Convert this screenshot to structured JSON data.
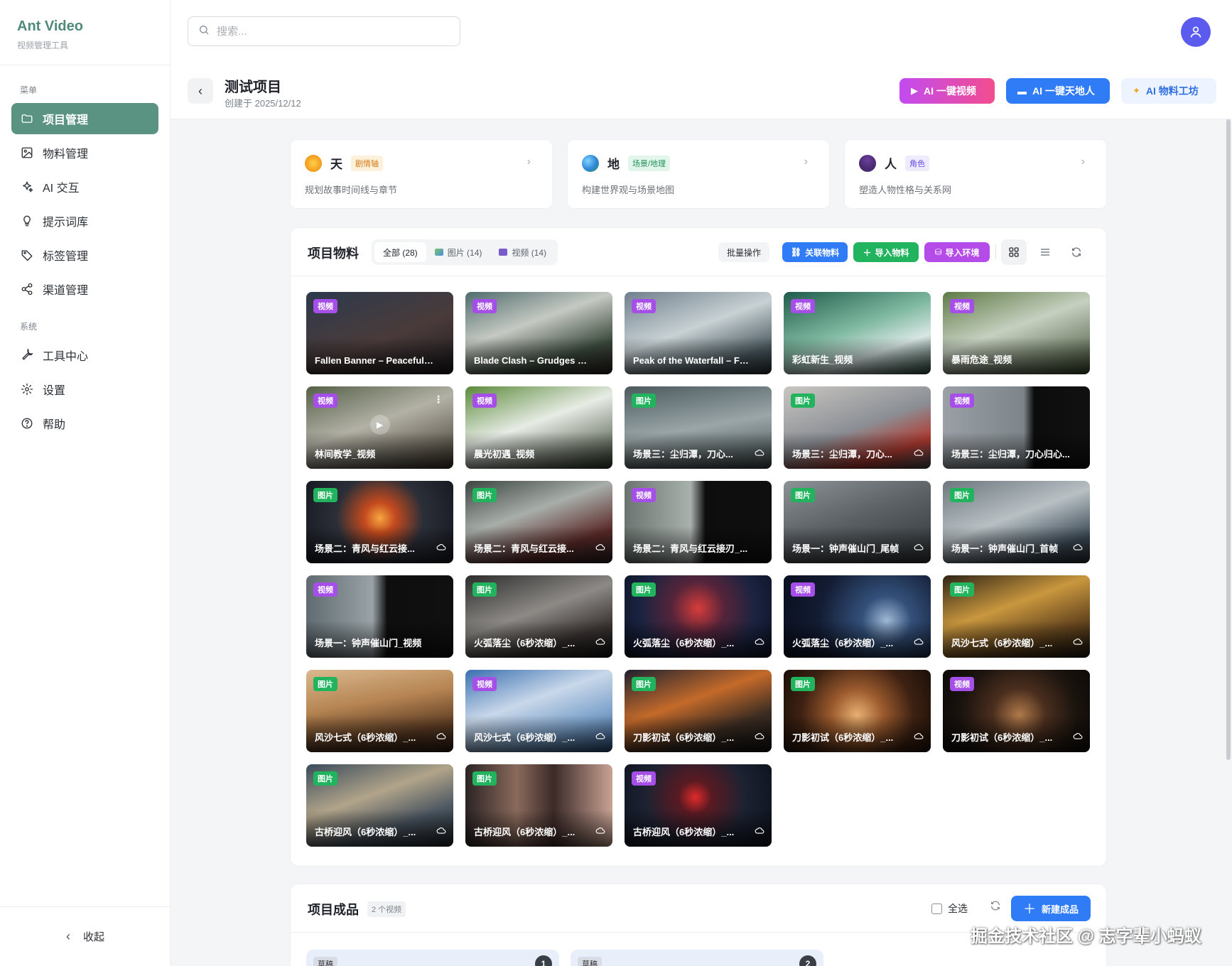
{
  "brand": {
    "name": "Ant Video",
    "subtitle": "视频管理工具"
  },
  "sidebar": {
    "menu_label": "菜单",
    "menu_items": [
      {
        "label": "项目管理",
        "icon": "folder-icon",
        "active": true
      },
      {
        "label": "物料管理",
        "icon": "image-icon"
      },
      {
        "label": "AI 交互",
        "icon": "sparkle-icon"
      },
      {
        "label": "提示词库",
        "icon": "lightbulb-icon"
      },
      {
        "label": "标签管理",
        "icon": "tag-icon"
      },
      {
        "label": "渠道管理",
        "icon": "share-icon"
      }
    ],
    "system_label": "系统",
    "system_items": [
      {
        "label": "工具中心",
        "icon": "wrench-icon"
      },
      {
        "label": "设置",
        "icon": "gear-icon"
      },
      {
        "label": "帮助",
        "icon": "help-icon"
      }
    ],
    "collapse_label": "收起"
  },
  "search": {
    "placeholder": "搜索..."
  },
  "project": {
    "title": "测试项目",
    "created": "创建于 2025/12/12",
    "buttons": {
      "ai_video": "AI 一键视频",
      "ai_world": "AI 一键天地人",
      "ai_lab": "AI 物料工坊"
    }
  },
  "cards": [
    {
      "name": "天",
      "tag": "剧情轴",
      "desc": "规划故事时间线与章节",
      "tag_bg": "#fdf1dc",
      "tag_fg": "#d07a16",
      "icon": "sun-icon"
    },
    {
      "name": "地",
      "tag": "场景/地理",
      "desc": "构建世界观与场景地图",
      "tag_bg": "#e3f6ec",
      "tag_fg": "#23915a",
      "icon": "globe-icon"
    },
    {
      "name": "人",
      "tag": "角色",
      "desc": "塑造人物性格与关系网",
      "tag_bg": "#eeeaff",
      "tag_fg": "#6a4ee0",
      "icon": "person-icon"
    }
  ],
  "materials": {
    "title": "项目物料",
    "filters": [
      "全部 (28)",
      "图片 (14)",
      "视频 (14)"
    ],
    "batch": "批量操作",
    "link": "关联物料",
    "import": "导入物料",
    "import_env": "导入环境",
    "items": [
      {
        "type": "视频",
        "kind": "video",
        "name": "Fallen Banner – Peaceful R...",
        "bg": "linear-gradient(160deg,#2d3a4d 0%,#4a3b3a 55%,#1d1a1d 100%)"
      },
      {
        "type": "视频",
        "kind": "video",
        "name": "Blade Clash – Grudges Unl...",
        "bg": "linear-gradient(160deg,#4f6b6d 0%,#c5c9c2 40%,#3b4a3d 75%,#2a2320 100%)"
      },
      {
        "type": "视频",
        "kind": "video",
        "name": "Peak of the Waterfall – Fou...",
        "bg": "linear-gradient(160deg,#6f7f8c 0%,#c8d1d4 45%,#4b5a60 80%,#2e3437 100%)"
      },
      {
        "type": "视频",
        "kind": "video",
        "name": "彩虹新生_视频",
        "bg": "linear-gradient(160deg,#1f5b4a 0%,#7fb9a1 45%,#d8e6e4 70%,#2c4a3f 100%)"
      },
      {
        "type": "视频",
        "kind": "video",
        "name": "暴雨危途_视频",
        "bg": "linear-gradient(160deg,#5e7a45 0%,#c6d0c0 45%,#3a4a2e 100%)"
      },
      {
        "type": "视频",
        "kind": "video",
        "name": "林间教学_视频",
        "bg": "linear-gradient(160deg,#556148 0%,#b3b1a6 45%,#3b3328 100%)",
        "play": true
      },
      {
        "type": "视频",
        "kind": "video",
        "name": "晨光初遇_视频",
        "bg": "linear-gradient(160deg,#5b8a3a 0%,#e7ece5 45%,#2f3a28 100%)"
      },
      {
        "type": "图片",
        "kind": "image",
        "name": "场景三：尘归潭，刀心...",
        "bg": "linear-gradient(170deg,#4c5a5e 0%,#9aa6a8 50%,#3e484a 100%)",
        "cloud": true
      },
      {
        "type": "图片",
        "kind": "image",
        "name": "场景三：尘归潭，刀心...",
        "bg": "linear-gradient(160deg,#c9c6c1 0%,#8b8f95 50%,#b13a30 78%,#4a4d52 100%)",
        "cloud": true
      },
      {
        "type": "视频",
        "kind": "video",
        "name": "场景三：尘归潭，刀心归心...",
        "bg": "linear-gradient(90deg,#9aa0a5 0%,#7d858a 55%,#0c0c0c 62%,#111 100%)"
      },
      {
        "type": "图片",
        "kind": "image",
        "name": "场景二：青风与红云接...",
        "bg": "radial-gradient(circle at 50% 45%,#f6a640 0%,#c44a1e 18%,#2b2f38 50%,#15181f 100%)",
        "cloud": true
      },
      {
        "type": "图片",
        "kind": "image",
        "name": "场景二：青风与红云接...",
        "bg": "linear-gradient(160deg,#3c4540 0%,#a8aeaa 40%,#5b2a28 75%,#2a2324 100%)",
        "cloud": true
      },
      {
        "type": "视频",
        "kind": "video",
        "name": "场景二：青风与红云接刃_...",
        "bg": "linear-gradient(90deg,#6b7470 0%,#a9b1ad 45%,#0d0d0d 55%,#0f0f0f 100%)"
      },
      {
        "type": "图片",
        "kind": "image",
        "name": "场景一：钟声催山门_尾帧",
        "bg": "linear-gradient(160deg,#8d9296 0%,#5c6266 45%,#2f3437 100%)",
        "cloud": true
      },
      {
        "type": "图片",
        "kind": "image",
        "name": "场景一：钟声催山门_首帧",
        "bg": "linear-gradient(160deg,#6d777d 0%,#b8c0c4 45%,#3c4a56 80%,#2a2f33 100%)",
        "cloud": true
      },
      {
        "type": "视频",
        "kind": "video",
        "name": "场景一：钟声催山门_视频",
        "bg": "linear-gradient(90deg,#5f6b70 0%,#9aa3a7 45%,#0e0e0e 55%,#101010 100%)"
      },
      {
        "type": "图片",
        "kind": "image",
        "name": "火弧落尘（6秒浓缩）_...",
        "bg": "linear-gradient(160deg,#2d2c2c 0%,#8d8a86 45%,#3b3533 75%,#141414 100%)",
        "cloud": true
      },
      {
        "type": "图片",
        "kind": "image",
        "name": "火弧落尘（6秒浓缩）_...",
        "bg": "radial-gradient(circle at 50% 40%,#d63c3a 0%,#55243a 30%,#1a2340 65%,#0d1224 100%)",
        "cloud": true
      },
      {
        "type": "视频",
        "kind": "video",
        "name": "火弧落尘（6秒浓缩）_...",
        "bg": "radial-gradient(circle at 70% 55%,#9eb8d6 0%,#33507a 22%,#131c33 60%,#0a0f1f 100%)",
        "cloud": true
      },
      {
        "type": "图片",
        "kind": "image",
        "name": "风沙七式（6秒浓缩）_...",
        "bg": "linear-gradient(160deg,#2f2416 0%,#c9973e 40%,#6b4a20 70%,#1c150e 100%)",
        "cloud": true
      },
      {
        "type": "图片",
        "kind": "image",
        "name": "风沙七式（6秒浓缩）_...",
        "bg": "linear-gradient(170deg,#d9b98f 0%,#b68452 40%,#5a3a22 75%,#2c1d12 100%)",
        "cloud": true
      },
      {
        "type": "视频",
        "kind": "video",
        "name": "风沙七式（6秒浓缩）_...",
        "bg": "linear-gradient(160deg,#3a6fb0 0%,#c9d8ea 40%,#7ba1c9 70%,#2d4f7d 100%)",
        "cloud": true
      },
      {
        "type": "图片",
        "kind": "image",
        "name": "刀影初试（6秒浓缩）_...",
        "bg": "linear-gradient(160deg,#1e2030 0%,#c46a2a 40%,#3b2c22 70%,#111 100%)",
        "cloud": true
      },
      {
        "type": "图片",
        "kind": "image",
        "name": "刀影初试（6秒浓缩）_...",
        "bg": "radial-gradient(circle at 50% 55%,#e8b071 0%,#9b5a2d 30%,#3d2112 65%,#1a0f08 100%)",
        "cloud": true
      },
      {
        "type": "视频",
        "kind": "video",
        "name": "刀影初试（6秒浓缩）_...",
        "bg": "radial-gradient(circle at 52% 55%,#b07a4a 0%,#4a2e1e 30%,#1a130e 65%,#0b0806 100%)",
        "cloud": true
      },
      {
        "type": "图片",
        "kind": "image",
        "name": "古桥迎风（6秒浓缩）_...",
        "bg": "linear-gradient(160deg,#3a4b5a 0%,#b1a48a 40%,#4a5560 70%,#1d2328 100%)",
        "cloud": true
      },
      {
        "type": "图片",
        "kind": "image",
        "name": "古桥迎风（6秒浓缩）_...",
        "bg": "linear-gradient(90deg,#2b2424 0%,#8a6a5c 35%,#3b2a28 60%,#c9a394 100%)",
        "cloud": true
      },
      {
        "type": "视频",
        "kind": "video",
        "name": "古桥迎风（6秒浓缩）_...",
        "bg": "radial-gradient(circle at 48% 40%,#e02a2a 0%,#5a1a22 18%,#1c2232 55%,#0c101a 100%)",
        "cloud": true
      }
    ]
  },
  "products": {
    "title": "项目成品",
    "count": "2 个视频",
    "select_all": "全选",
    "new_button": "新建成品",
    "cards": [
      {
        "tag": "草稿",
        "num": "1"
      },
      {
        "tag": "草稿",
        "num": "2"
      }
    ]
  },
  "watermark": "掘金技术社区 @ 志字辈小蚂蚁",
  "colors": {
    "accent": "#5a9381",
    "primary": "#2f7cf6",
    "green": "#22b35e",
    "purple": "#b54be8",
    "avatar": "#5b5bf0"
  }
}
